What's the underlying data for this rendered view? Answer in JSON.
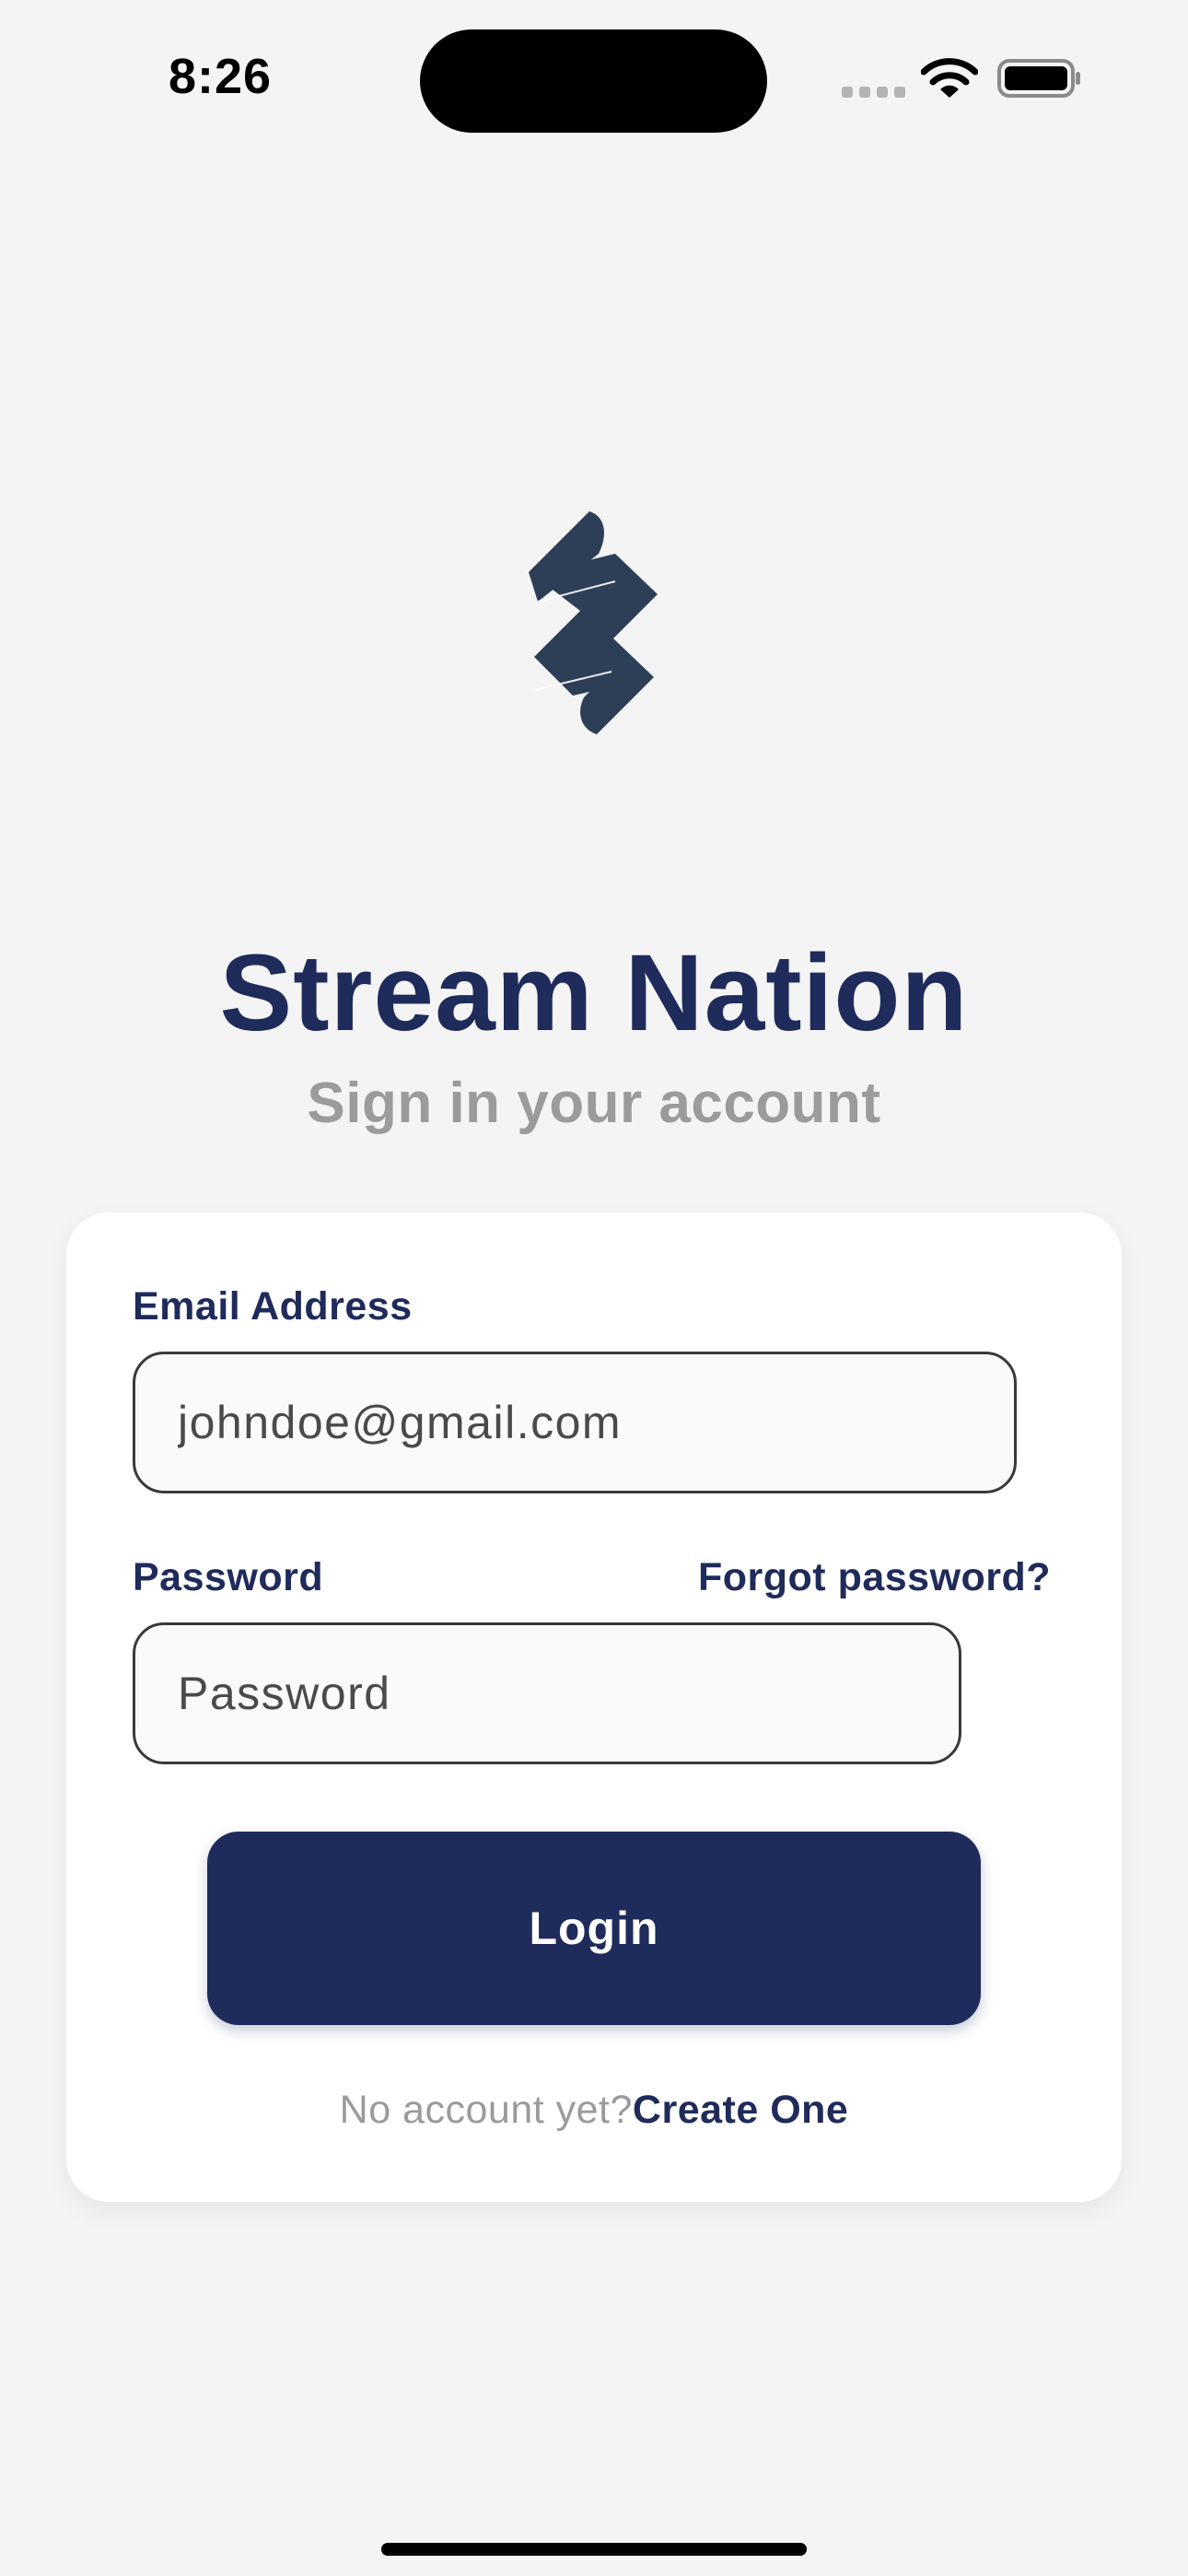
{
  "status_bar": {
    "time": "8:26",
    "icons": [
      "cellular-signal-icon",
      "wifi-icon",
      "battery-icon"
    ]
  },
  "app": {
    "logo_icon": "stream-nation-logo",
    "title": "Stream Nation",
    "subtitle": "Sign in your account"
  },
  "form": {
    "email_label": "Email Address",
    "email_value": "johndoe@gmail.com",
    "password_label": "Password",
    "password_placeholder": "Password",
    "forgot_password": "Forgot password?",
    "login_button": "Login",
    "signup_prompt": "No account yet?",
    "signup_link": "Create One"
  },
  "colors": {
    "brand_navy": "#1f2b5a",
    "logo": "#2d3f57",
    "muted_text": "#9b9b9b",
    "background": "#f4f4f4",
    "card": "#ffffff"
  }
}
